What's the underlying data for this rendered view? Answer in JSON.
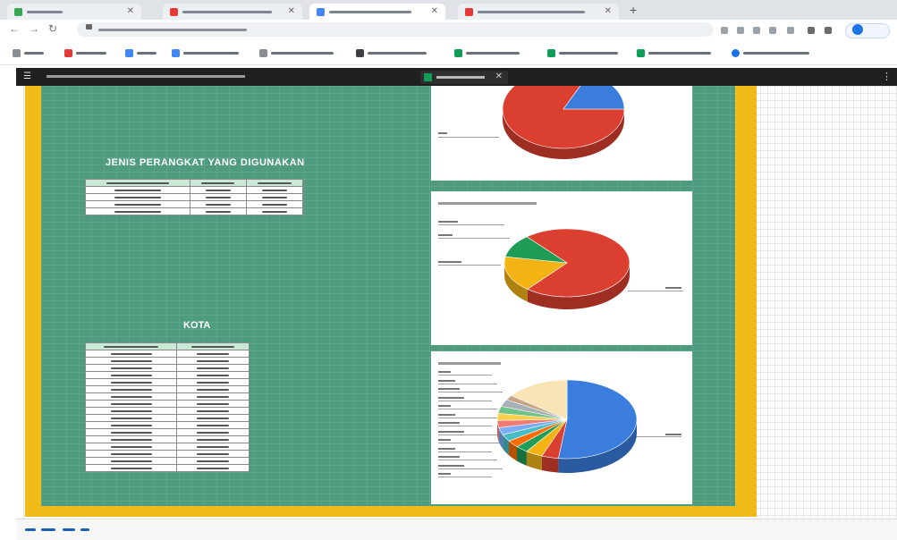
{
  "colors": {
    "sheet_background": "#4f9b7e",
    "frame_yellow": "#f1bc19",
    "slice_red": "#db3f2f",
    "slice_blue": "#3b7ddd",
    "slice_yellow": "#f3b313",
    "slice_green": "#1f9c55",
    "slice_cream": "#f8e4b4",
    "table_header": "#c9e9d6"
  },
  "browser": {
    "tabs": [
      {
        "label": "",
        "favicon_color": "#34a853"
      },
      {
        "label": "",
        "favicon_color": "#e53935"
      },
      {
        "label": "",
        "favicon_color": "#4285f4"
      },
      {
        "label": "",
        "favicon_color": "#e53935"
      }
    ],
    "new_tab_glyph": "+",
    "url": "",
    "bookmarks": [
      {
        "label": "",
        "icon_color": "#8a8f96"
      },
      {
        "label": "",
        "icon_color": "#e53935"
      },
      {
        "label": "",
        "icon_color": "#4285f4"
      },
      {
        "label": "",
        "icon_color": "#4285f4"
      },
      {
        "label": "",
        "icon_color": "#8a8f96"
      },
      {
        "label": "",
        "icon_color": "#3c4043"
      },
      {
        "label": "",
        "icon_color": "#0f9d58"
      },
      {
        "label": "",
        "icon_color": "#0f9d58"
      },
      {
        "label": "",
        "icon_color": "#0f9d58"
      },
      {
        "label": "",
        "icon_color": "#1a73e8"
      }
    ]
  },
  "sheet": {
    "title": "",
    "tab_label": "",
    "headings": {
      "jenis": "JENIS PERANGKAT YANG DIGUNAKAN",
      "kota": "KOTA"
    }
  },
  "tables": {
    "jenis": {
      "columns": 3,
      "rows": 5
    },
    "kota": {
      "columns": 2,
      "rows": 18
    }
  },
  "chart_data": [
    {
      "type": "pie",
      "title": "",
      "series": [
        {
          "name": "",
          "value": 82,
          "color": "#db3f2f"
        },
        {
          "name": "",
          "value": 18,
          "color": "#3b7ddd"
        }
      ]
    },
    {
      "type": "pie",
      "title": "",
      "series": [
        {
          "name": "",
          "value": 72,
          "color": "#db3f2f"
        },
        {
          "name": "",
          "value": 17,
          "color": "#f3b313"
        },
        {
          "name": "",
          "value": 11,
          "color": "#1f9c55"
        }
      ]
    },
    {
      "type": "pie",
      "title": "",
      "series": [
        {
          "name": "",
          "value": 53,
          "color": "#3b7ddd"
        },
        {
          "name": "",
          "value": 4,
          "color": "#db3f2f"
        },
        {
          "name": "",
          "value": 4,
          "color": "#f3b313"
        },
        {
          "name": "",
          "value": 3,
          "color": "#1f9c55"
        },
        {
          "name": "",
          "value": 3,
          "color": "#ff6d01"
        },
        {
          "name": "",
          "value": 3,
          "color": "#46bdc6"
        },
        {
          "name": "",
          "value": 3,
          "color": "#7baaf7"
        },
        {
          "name": "",
          "value": 3,
          "color": "#f07b72"
        },
        {
          "name": "",
          "value": 3,
          "color": "#fcd04f"
        },
        {
          "name": "",
          "value": 3,
          "color": "#71c287"
        },
        {
          "name": "",
          "value": 3,
          "color": "#a8b1b6"
        },
        {
          "name": "",
          "value": 2,
          "color": "#c4a484"
        },
        {
          "name": "",
          "value": 15,
          "color": "#f8e4b4"
        }
      ]
    }
  ],
  "bottom_links": [
    {
      "label": "",
      "color": "#1a5fb4"
    },
    {
      "label": "",
      "color": "#1a5fb4"
    },
    {
      "label": "",
      "color": "#1a5fb4"
    },
    {
      "label": "",
      "color": "#1a5fb4"
    }
  ]
}
